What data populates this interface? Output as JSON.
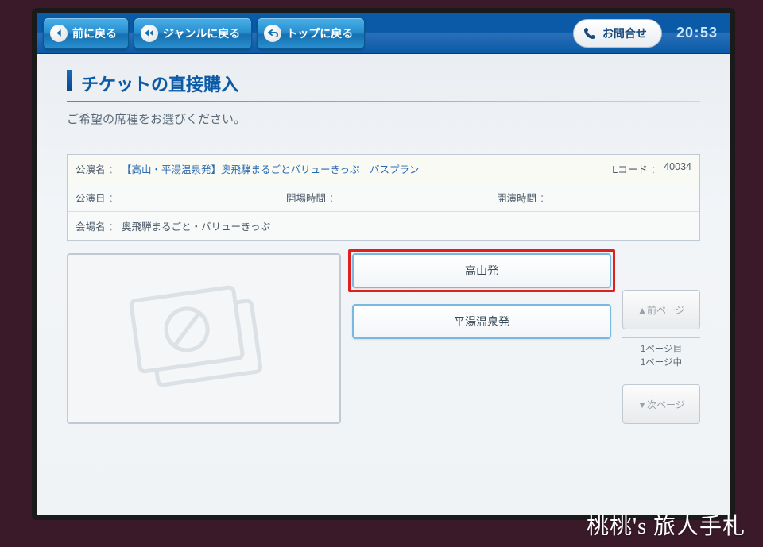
{
  "nav": {
    "back": "前に戻る",
    "genre": "ジャンルに戻る",
    "top": "トップに戻る",
    "inquiry": "お問合せ"
  },
  "clock": {
    "hour": "20",
    "min": "53"
  },
  "title": "チケットの直接購入",
  "subtitle": "ご希望の席種をお選びください。",
  "info": {
    "event_name_label": "公演名",
    "event_name": "【高山・平湯温泉発】奥飛騨まるごとバリューきっぷ　バスプラン",
    "lcode_label": "Lコード",
    "lcode": "40034",
    "date_label": "公演日",
    "date": "－",
    "open_label": "開場時間",
    "open": "－",
    "start_label": "開演時間",
    "start": "－",
    "venue_label": "会場名",
    "venue": "奥飛騨まるごと・バリューきっぷ"
  },
  "options": {
    "opt1": "高山発",
    "opt2": "平湯温泉発"
  },
  "pager": {
    "prev": "▲前ページ",
    "page_current": "1ページ目",
    "page_total": "1ページ中",
    "next": "▼次ページ"
  },
  "watermark": "桃桃's 旅人手札"
}
